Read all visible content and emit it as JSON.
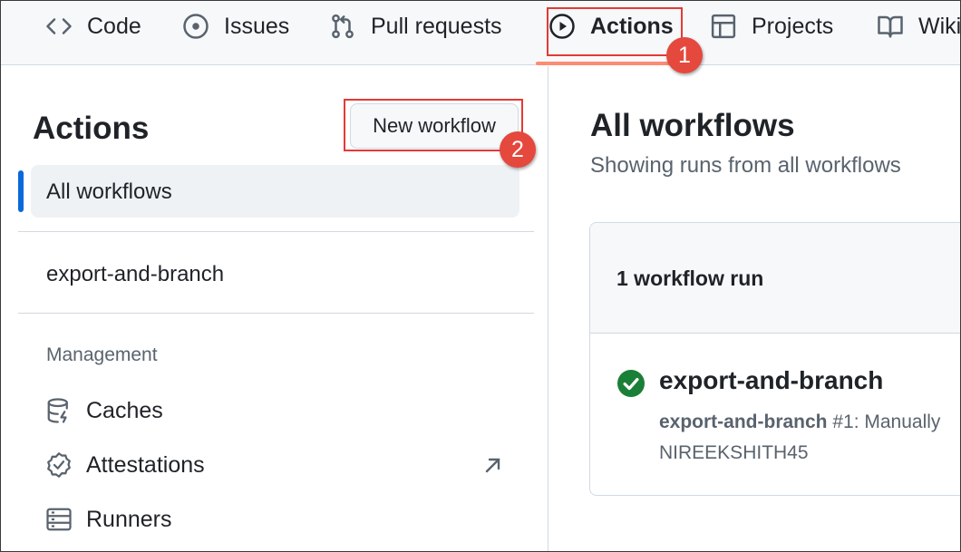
{
  "topnav": {
    "tabs": [
      {
        "label": "Code",
        "icon": "code-icon"
      },
      {
        "label": "Issues",
        "icon": "issue-opened-icon"
      },
      {
        "label": "Pull requests",
        "icon": "git-pull-request-icon"
      },
      {
        "label": "Actions",
        "icon": "play-icon",
        "selected": true
      },
      {
        "label": "Projects",
        "icon": "table-icon"
      },
      {
        "label": "Wiki",
        "icon": "book-icon"
      }
    ]
  },
  "annotations": {
    "step1": "1",
    "step2": "2",
    "highlight_color": "#e53935"
  },
  "sidebar": {
    "title": "Actions",
    "new_workflow_label": "New workflow",
    "all_workflows_label": "All workflows",
    "workflows": [
      "export-and-branch"
    ],
    "management_label": "Management",
    "management_items": [
      {
        "label": "Caches",
        "icon": "database-icon"
      },
      {
        "label": "Attestations",
        "icon": "verified-icon",
        "external": true
      },
      {
        "label": "Runners",
        "icon": "server-icon"
      }
    ]
  },
  "main": {
    "title": "All workflows",
    "subtitle": "Showing runs from all workflows",
    "run_count_label": "1 workflow run",
    "runs": [
      {
        "name": "export-and-branch",
        "status": "success",
        "workflow": "export-and-branch",
        "detail": "#1: Manually",
        "actor": "NIREEKSHITH45"
      }
    ]
  },
  "colors": {
    "accent_blue": "#0969da",
    "success_green": "#1a7f37",
    "tab_underline": "#fd8c73"
  }
}
